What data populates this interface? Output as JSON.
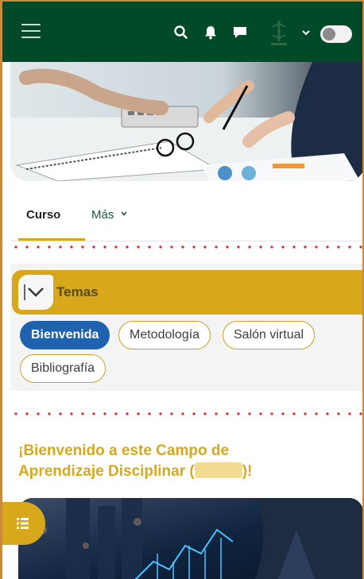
{
  "navbar": {
    "background": "#004a2a",
    "icons": [
      "menu-icon",
      "search-icon",
      "bell-icon",
      "chat-icon",
      "chevron-down-icon"
    ]
  },
  "tabs": {
    "curso": "Curso",
    "mas": "Más"
  },
  "temas": {
    "title": "Temas",
    "pills": [
      "Bienvenida",
      "Metodología",
      "Salón virtual",
      "Bibliografía"
    ],
    "active": "Bienvenida"
  },
  "welcome": {
    "line1": "¡Bienvenido a este Campo de",
    "line2_pre": "Aprendizaje Disciplinar (",
    "line2_post": ")!"
  },
  "colors": {
    "accent": "#d7a81a",
    "primary_blue": "#1f63b0",
    "nav_green": "#004a2a"
  }
}
